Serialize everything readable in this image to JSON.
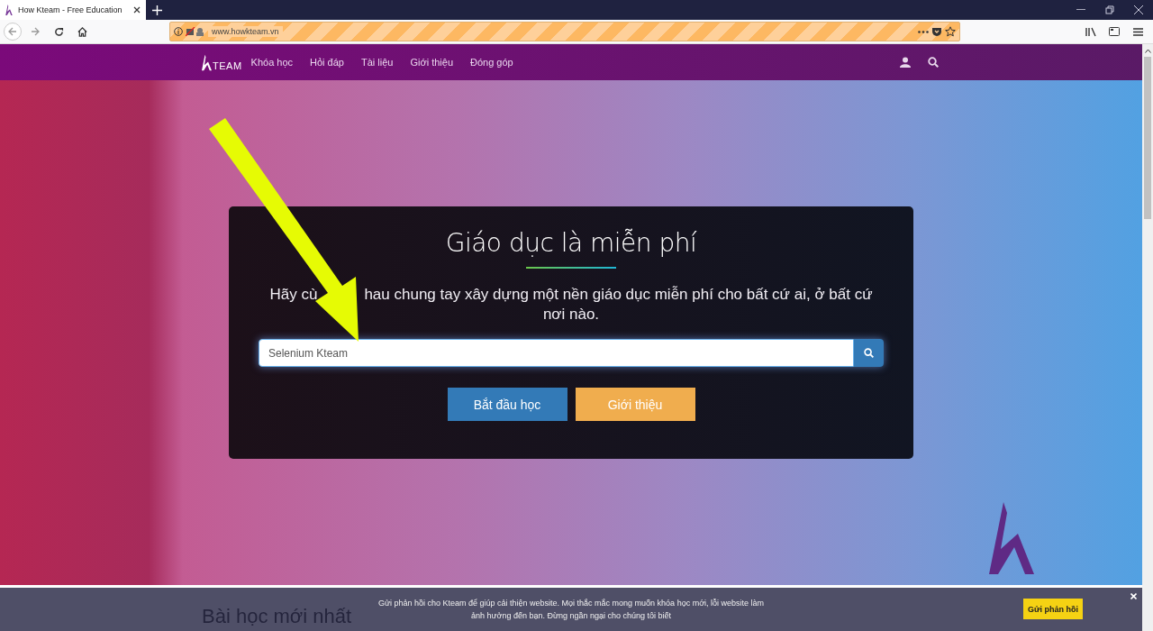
{
  "browser": {
    "tab": {
      "title": "How Kteam - Free Education"
    },
    "address": "www.howkteam.vn"
  },
  "nav": {
    "logo": "TEAM",
    "items": [
      "Khóa học",
      "Hỏi đáp",
      "Tài liệu",
      "Giới thiệu",
      "Đóng góp"
    ]
  },
  "hero": {
    "title": "Giáo dục là miễn phí",
    "subtitle_parts": [
      "Hãy cù",
      "hau chung tay xây dựng một nền giáo dục miễn phí cho bất cứ ai, ở bất cứ nơi nào."
    ],
    "search": {
      "value": "Selenium Kteam"
    },
    "buttons": [
      {
        "label": "Bắt đầu học",
        "kind": "primary"
      },
      {
        "label": "Giới thiệu",
        "kind": "warning"
      }
    ]
  },
  "section_heading": "Bài học mới nhất",
  "feedback": {
    "message": "Gửi phản hồi cho Kteam để giúp cải thiện website. Mọi thắc mắc mong muốn khóa học mới, lỗi website làm ảnh hưởng đến bạn. Đừng ngần ngại cho chúng tôi biết",
    "button": "Gửi phản hồi"
  }
}
